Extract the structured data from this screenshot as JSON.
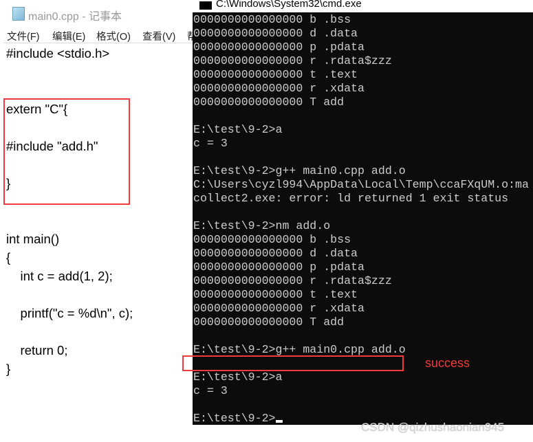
{
  "notepad": {
    "title": "main0.cpp - 记事本",
    "menu": [
      "文件(F)",
      "编辑(E)",
      "格式(O)",
      "查看(V)",
      "帮"
    ],
    "lines": [
      "#include <stdio.h>",
      "",
      "",
      "extern \"C\"{",
      "",
      "#include \"add.h\"",
      "",
      "}",
      "",
      "",
      "int main()",
      "{",
      "    int c = add(1, 2);",
      "",
      "    printf(\"c = %d\\n\", c);",
      "",
      "    return 0;",
      "}"
    ]
  },
  "cmd": {
    "title": "C:\\Windows\\System32\\cmd.exe",
    "lines": [
      "0000000000000000 b .bss",
      "0000000000000000 d .data",
      "0000000000000000 p .pdata",
      "0000000000000000 r .rdata$zzz",
      "0000000000000000 t .text",
      "0000000000000000 r .xdata",
      "0000000000000000 T add",
      "",
      "E:\\test\\9-2>a",
      "c = 3",
      "",
      "E:\\test\\9-2>g++ main0.cpp add.o",
      "C:\\Users\\cyzl994\\AppData\\Local\\Temp\\ccaFXqUM.o:ma",
      "collect2.exe: error: ld returned 1 exit status",
      "",
      "E:\\test\\9-2>nm add.o",
      "0000000000000000 b .bss",
      "0000000000000000 d .data",
      "0000000000000000 p .pdata",
      "0000000000000000 r .rdata$zzz",
      "0000000000000000 t .text",
      "0000000000000000 r .xdata",
      "0000000000000000 T add",
      "",
      "E:\\test\\9-2>g++ main0.cpp add.o",
      "",
      "E:\\test\\9-2>a",
      "c = 3",
      "",
      "E:\\test\\9-2>"
    ]
  },
  "annotation": {
    "success_label": "success",
    "color": "#ef3b3b"
  },
  "watermark": "CSDN @qizhushaonian945"
}
